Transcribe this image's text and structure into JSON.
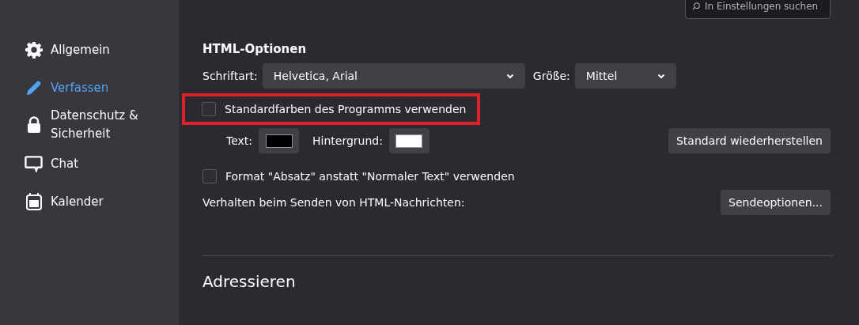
{
  "search": {
    "placeholder": "In Einstellungen suchen"
  },
  "sidebar": {
    "items": [
      {
        "label": "Allgemein",
        "kind": "gear",
        "selected": false
      },
      {
        "label": "Verfassen",
        "kind": "pencil",
        "selected": true
      },
      {
        "label": "Datenschutz & Sicherheit",
        "kind": "lock",
        "selected": false
      },
      {
        "label": "Chat",
        "kind": "chat",
        "selected": false
      },
      {
        "label": "Kalender",
        "kind": "calendar",
        "selected": false
      }
    ]
  },
  "html_options": {
    "heading": "HTML-Optionen",
    "font": {
      "label": "Schriftart:",
      "value": "Helvetica, Arial"
    },
    "size": {
      "label": "Größe:",
      "value": "Mittel"
    },
    "default_colors": {
      "label": "Standardfarben des Programms verwenden",
      "checked": false,
      "highlighted": true
    },
    "text_color": {
      "label": "Text:",
      "color": "#000000"
    },
    "background_color": {
      "label": "Hintergrund:",
      "color": "#ffffff"
    },
    "restore_button": {
      "label": "Standard wiederherstellen"
    },
    "paragraph_format": {
      "label": "Format \"Absatz\" anstatt \"Normaler Text\" verwenden",
      "checked": false
    },
    "send_label": "Verhalten beim Senden von HTML-Nachrichten:",
    "send_button": {
      "label": "Sendeoptionen..."
    }
  },
  "addressing": {
    "heading": "Adressieren"
  }
}
